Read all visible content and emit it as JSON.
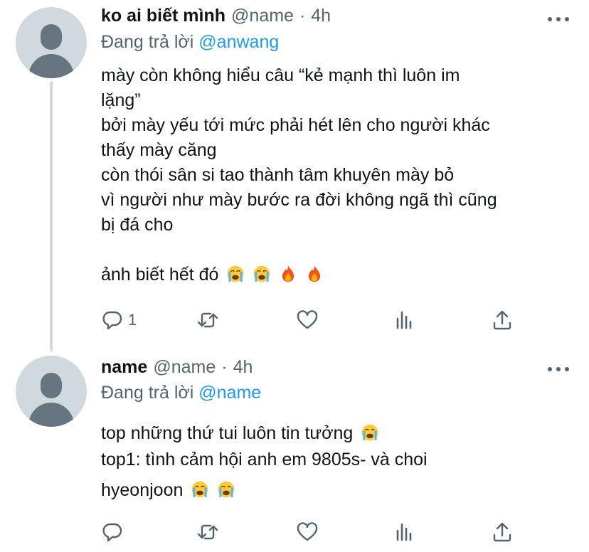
{
  "tweets": [
    {
      "name": "ko ai biết mình",
      "handle": "@name",
      "dot": "·",
      "time": "4h",
      "replying_prefix": "Đang trả lời",
      "replying_to": "@anwang",
      "lines": [
        "mày còn không hiểu câu “kẻ mạnh thì luôn im",
        "lặng”",
        "bởi mày yếu tới mức phải hét lên cho người khác",
        "thấy mày căng",
        "còn thói sân si tao thành tâm khuyên mày bỏ",
        "vì người như mày bước ra đời không ngã thì cũng",
        "bị đá cho"
      ],
      "last_line": "ảnh biết hết đó",
      "last_line_emojis": [
        "loudly-crying-face",
        "loudly-crying-face",
        "fire",
        "fire"
      ],
      "reply_count": "1",
      "retweet_count": "",
      "like_count": ""
    },
    {
      "name": "name",
      "handle": "@name",
      "dot": "·",
      "time": "4h",
      "replying_prefix": "Đang trả lời",
      "replying_to": "@name",
      "line1": "top những thứ tui luôn tin tưởng",
      "line1_emojis": [
        "loudly-crying-face"
      ],
      "line2": "top1: tình cảm hội anh em 9805s- và choi",
      "line3": "hyeonjoon",
      "line3_emojis": [
        "loudly-crying-face",
        "loudly-crying-face"
      ],
      "reply_count": "",
      "retweet_count": "",
      "like_count": ""
    }
  ],
  "icons": {
    "reply": "reply-icon",
    "retweet": "retweet-icon",
    "like": "heart-icon",
    "views": "views-icon",
    "share": "share-icon",
    "more": "more-icon"
  },
  "colors": {
    "text": "#0f1419",
    "secondary": "#536471",
    "link": "#1d9bf0",
    "avatar_bg": "#cfd9de",
    "avatar_fg": "#66757f"
  }
}
